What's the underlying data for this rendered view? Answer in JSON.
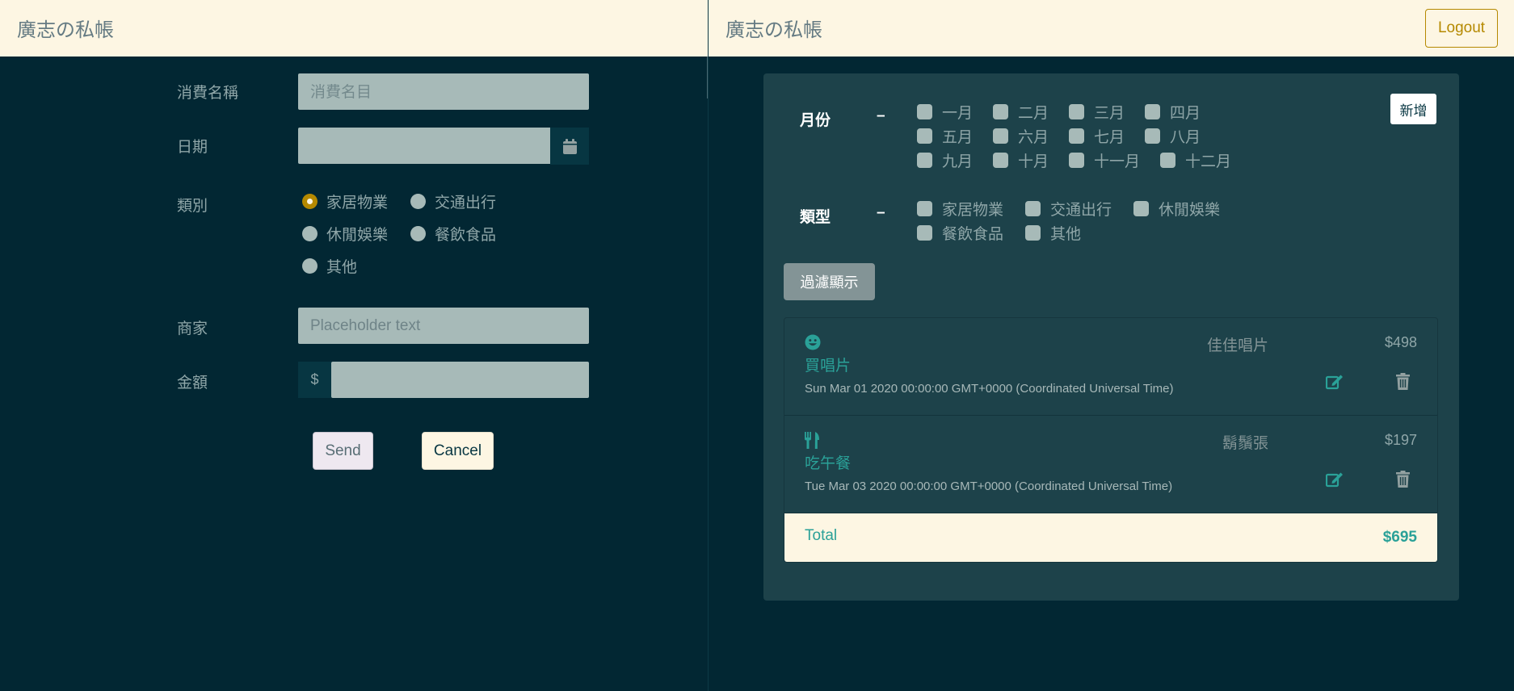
{
  "left": {
    "brand": "廣志の私帳",
    "form": {
      "name_label": "消費名稱",
      "name_placeholder": "消費名目",
      "date_label": "日期",
      "date_value": "",
      "category_label": "類別",
      "categories": [
        {
          "label": "家居物業",
          "checked": true
        },
        {
          "label": "交通出行",
          "checked": false
        },
        {
          "label": "休閒娛樂",
          "checked": false
        },
        {
          "label": "餐飲食品",
          "checked": false
        },
        {
          "label": "其他",
          "checked": false
        }
      ],
      "merchant_label": "商家",
      "merchant_placeholder": "Placeholder text",
      "amount_label": "金額",
      "currency_symbol": "$",
      "amount_value": "",
      "send_label": "Send",
      "cancel_label": "Cancel"
    }
  },
  "right": {
    "brand": "廣志の私帳",
    "logout_label": "Logout",
    "add_label": "新增",
    "filters": {
      "month_label": "月份",
      "month_dash": "–",
      "months": [
        "一月",
        "二月",
        "三月",
        "四月",
        "五月",
        "六月",
        "七月",
        "八月",
        "九月",
        "十月",
        "十一月",
        "十二月"
      ],
      "type_label": "類型",
      "type_dash": "–",
      "types": [
        "家居物業",
        "交通出行",
        "休閒娛樂",
        "餐飲食品",
        "其他"
      ],
      "apply_label": "過濾顯示"
    },
    "expenses": [
      {
        "icon": "smile-icon",
        "title": "買唱片",
        "date": "Sun Mar 01 2020 00:00:00 GMT+0000 (Coordinated Universal Time)",
        "merchant": "佳佳唱片",
        "amount": "$498"
      },
      {
        "icon": "utensils-icon",
        "title": "吃午餐",
        "date": "Tue Mar 03 2020 00:00:00 GMT+0000 (Coordinated Universal Time)",
        "merchant": "鬍鬚張",
        "amount": "$197"
      }
    ],
    "total_label": "Total",
    "total_value": "$695"
  },
  "colors": {
    "background": "#022733",
    "navbar": "#fdf6e3",
    "card": "#1d424a",
    "accent": "#2aa198",
    "radio_checked": "#b58900",
    "input": "#a7bab8"
  }
}
